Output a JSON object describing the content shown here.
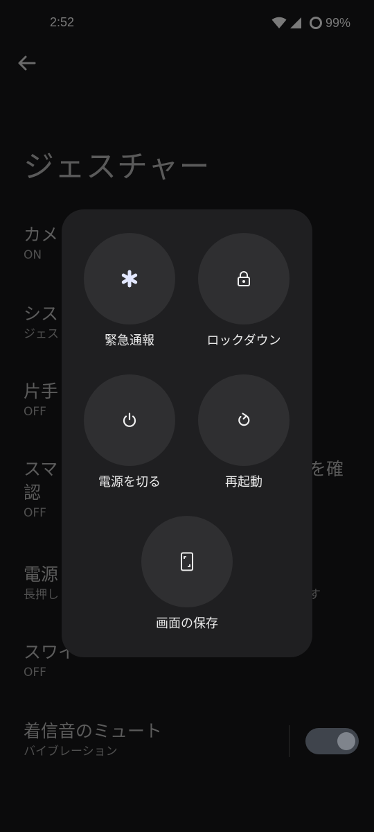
{
  "status_bar": {
    "time": "2:52",
    "battery_percent": "99%",
    "icons": [
      "wifi-icon",
      "cellular-signal-icon",
      "battery-ring-icon"
    ]
  },
  "header": {
    "back_icon": "arrow-back-icon",
    "title": "ジェスチャー"
  },
  "settings": [
    {
      "title": "カメ",
      "subtitle": "ON"
    },
    {
      "title": "シス",
      "subtitle": "ジェス"
    },
    {
      "title": "片手",
      "subtitle": "OFF"
    },
    {
      "title": "スマ",
      "title_right": "を確",
      "title_line2": "認",
      "subtitle": "OFF"
    },
    {
      "title": "電源",
      "subtitle": "長押し",
      "subtitle_right": "す"
    },
    {
      "title": "スワイ",
      "subtitle": "OFF"
    },
    {
      "title": "着信音のミュート",
      "subtitle": "バイブレーション",
      "toggle_on": true
    }
  ],
  "power_menu": {
    "actions": [
      {
        "label": "緊急通報",
        "icon": "emergency-asterisk-icon"
      },
      {
        "label": "ロックダウン",
        "icon": "lock-icon"
      },
      {
        "label": "電源を切る",
        "icon": "power-icon"
      },
      {
        "label": "再起動",
        "icon": "restart-icon"
      },
      {
        "label": "画面の保存",
        "icon": "screenshot-icon"
      }
    ]
  },
  "colors": {
    "background": "#0b0b0c",
    "menu_surface": "#1f1f21",
    "action_circle": "#2f2f31",
    "emergency_accent": "#e3e8ff"
  }
}
